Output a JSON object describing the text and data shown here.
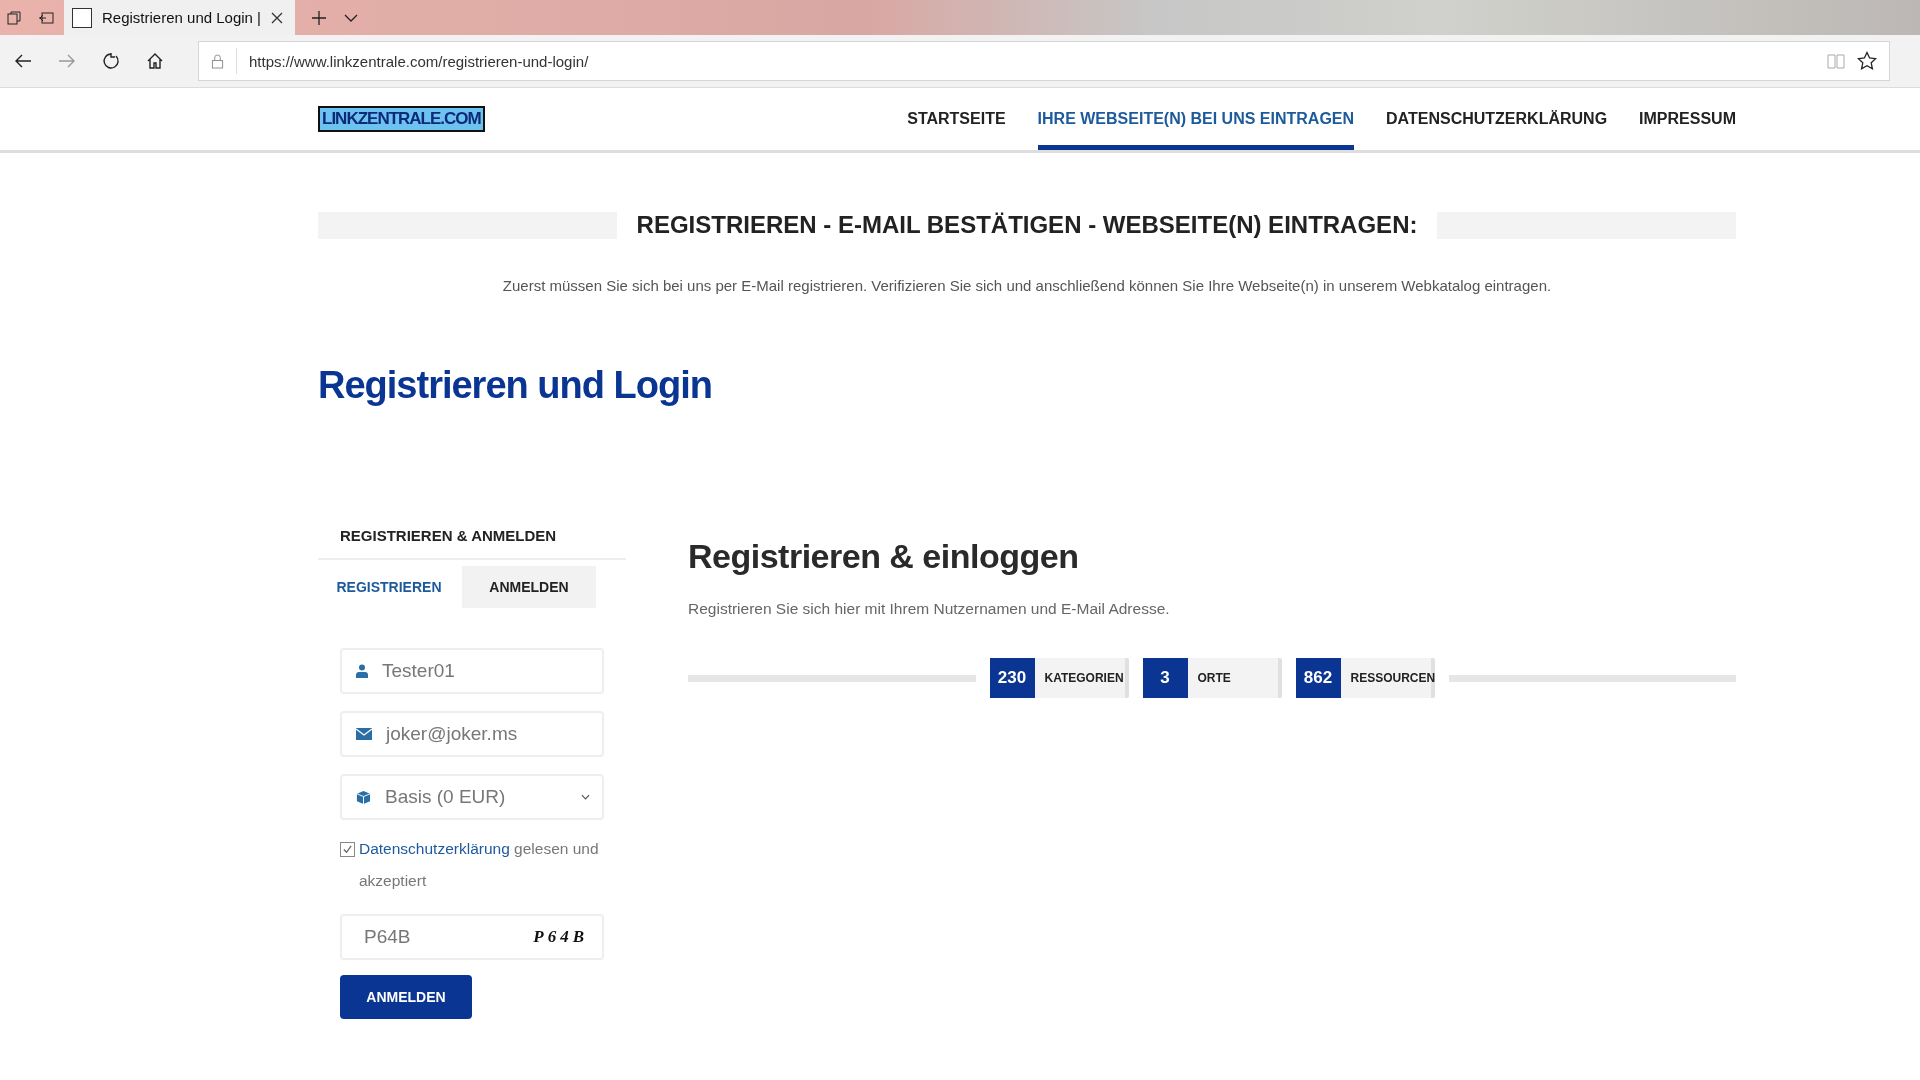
{
  "browser": {
    "tab_title": "Registrieren und Login |",
    "url": "https://www.linkzentrale.com/registrieren-und-login/"
  },
  "site": {
    "logo": "LINKZENTRALE.COM",
    "nav": [
      {
        "label": "STARTSEITE",
        "selected": false
      },
      {
        "label": "IHRE WEBSEITE(N) BEI UNS EINTRAGEN",
        "selected": true
      },
      {
        "label": "DATENSCHUTZERKLÄRUNG",
        "selected": false
      },
      {
        "label": "IMPRESSUM",
        "selected": false
      }
    ]
  },
  "banner": {
    "title": "REGISTRIEREN - E-MAIL BESTÄTIGEN - WEBSEITE(N) EINTRAGEN:",
    "text": "Zuerst müssen Sie sich bei uns per E-Mail registrieren. Verifizieren Sie sich und anschließend können Sie Ihre Webseite(n) in unserem Webkatalog eintragen."
  },
  "page_title": "Registrieren und Login",
  "sidebar": {
    "title": "REGISTRIEREN & ANMELDEN",
    "tabs": [
      {
        "label": "REGISTRIEREN",
        "selected": true
      },
      {
        "label": "ANMELDEN",
        "selected": false
      }
    ],
    "fields": [
      {
        "kind": "user",
        "value": "Tester01"
      },
      {
        "kind": "email",
        "value": "joker@joker.ms"
      },
      {
        "kind": "select",
        "value": "Basis (0 EUR)"
      }
    ],
    "consent": {
      "checked": true,
      "link": "Datenschutzerklärung",
      "text": " gelesen und akzeptiert"
    },
    "captcha": {
      "value": "P64B",
      "image_text": "P64B"
    },
    "submit": "ANMELDEN"
  },
  "main": {
    "title": "Registrieren & einloggen",
    "text": "Registrieren Sie sich hier mit Ihrem Nutzernamen und E-Mail Adresse.",
    "stats": [
      {
        "count": "230",
        "label": "KATEGORIEN"
      },
      {
        "count": "3",
        "label": "ORTE"
      },
      {
        "count": "862",
        "label": "RESSOURCEN"
      }
    ]
  }
}
